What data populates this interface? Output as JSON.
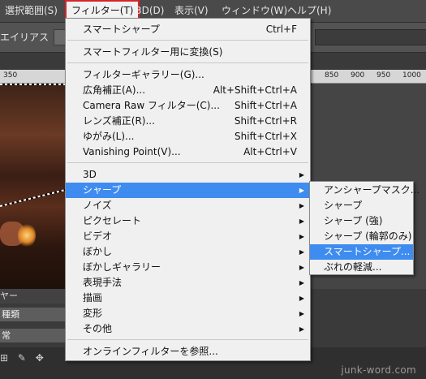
{
  "menubar": {
    "items": [
      "選択範囲(S)",
      "フィルター(T)",
      "3D(D)",
      "表示(V)",
      "ウィンドウ(W)",
      "ヘルプ(H)"
    ]
  },
  "options_bar": {
    "antialias_label": "エイリアス"
  },
  "ruler": {
    "ticks": [
      "350",
      "850",
      "900",
      "950",
      "1000"
    ]
  },
  "filter_menu": {
    "items": [
      {
        "label": "スマートシャープ",
        "shortcut": "Ctrl+F"
      },
      {
        "label": "スマートフィルター用に変換(S)",
        "shortcut": ""
      },
      {
        "label": "フィルターギャラリー(G)...",
        "shortcut": ""
      },
      {
        "label": "広角補正(A)...",
        "shortcut": "Alt+Shift+Ctrl+A"
      },
      {
        "label": "Camera Raw フィルター(C)...",
        "shortcut": "Shift+Ctrl+A"
      },
      {
        "label": "レンズ補正(R)...",
        "shortcut": "Shift+Ctrl+R"
      },
      {
        "label": "ゆがみ(L)...",
        "shortcut": "Shift+Ctrl+X"
      },
      {
        "label": "Vanishing Point(V)...",
        "shortcut": "Alt+Ctrl+V"
      },
      {
        "label": "3D",
        "submenu": true
      },
      {
        "label": "シャープ",
        "submenu": true,
        "highlighted": true
      },
      {
        "label": "ノイズ",
        "submenu": true
      },
      {
        "label": "ピクセレート",
        "submenu": true
      },
      {
        "label": "ビデオ",
        "submenu": true
      },
      {
        "label": "ぼかし",
        "submenu": true
      },
      {
        "label": "ぼかしギャラリー",
        "submenu": true
      },
      {
        "label": "表現手法",
        "submenu": true
      },
      {
        "label": "描画",
        "submenu": true
      },
      {
        "label": "変形",
        "submenu": true
      },
      {
        "label": "その他",
        "submenu": true
      },
      {
        "label": "オンラインフィルターを参照...",
        "shortcut": ""
      }
    ]
  },
  "sharpen_submenu": {
    "items": [
      {
        "label": "アンシャープマスク..."
      },
      {
        "label": "シャープ"
      },
      {
        "label": "シャープ (強)"
      },
      {
        "label": "シャープ (輪郭のみ)"
      },
      {
        "label": "スマートシャープ...",
        "highlighted": true
      },
      {
        "label": "ぶれの軽減..."
      }
    ]
  },
  "panels": {
    "header": "ヤー",
    "kind_label": "種類",
    "mode_label": "常"
  },
  "watermark": "junk-word.com",
  "colors": {
    "highlight": "#3e8cf0",
    "active_menu_border": "#d8242b"
  }
}
